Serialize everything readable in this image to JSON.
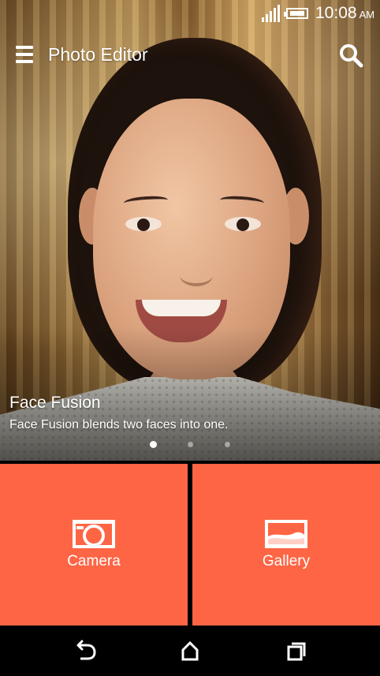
{
  "status_bar": {
    "time": "10:08",
    "ampm": "AM"
  },
  "app": {
    "title": "Photo Editor"
  },
  "carousel": {
    "title": "Face Fusion",
    "description": "Face Fusion blends two faces into one.",
    "page_count": 3,
    "active_index": 0
  },
  "tiles": [
    {
      "label": "Camera",
      "icon": "camera-icon"
    },
    {
      "label": "Gallery",
      "icon": "gallery-icon"
    }
  ],
  "navigation": {
    "back": "back-icon",
    "home": "home-icon",
    "recents": "recents-icon"
  },
  "colors": {
    "accent": "#fe6545",
    "navbar": "#000000",
    "text": "#ffffff"
  }
}
